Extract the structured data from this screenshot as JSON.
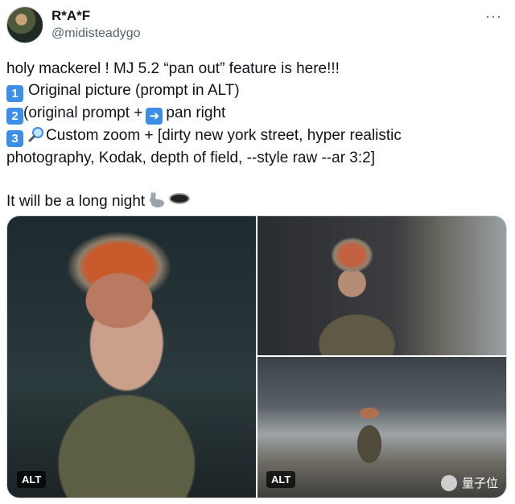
{
  "user": {
    "name": "R*A*F",
    "handle": "@midisteadygo"
  },
  "tweet": {
    "line1": "holy mackerel ! MJ 5.2 “pan out” feature is here!!!",
    "line2_num": "1",
    "line2_text": "Original picture (prompt in ALT)",
    "line3_num": "2",
    "line3_text_a": "(original prompt +",
    "line3_text_b": "pan right",
    "line4_num": "3",
    "line4_text": "Custom zoom  + [dirty new york street, hyper realistic",
    "line5_text": "photography, Kodak, depth of field, --style raw --ar 3:2]",
    "line6_text": "It will be a long night"
  },
  "media": {
    "alt_label": "ALT",
    "watermark": "量子位"
  },
  "icons": {
    "more": "more-options-icon",
    "arrow": "right-arrow-icon",
    "zoom": "magnifying-glass-icon",
    "rabbit": "rabbit-icon",
    "hole": "hole-icon"
  }
}
